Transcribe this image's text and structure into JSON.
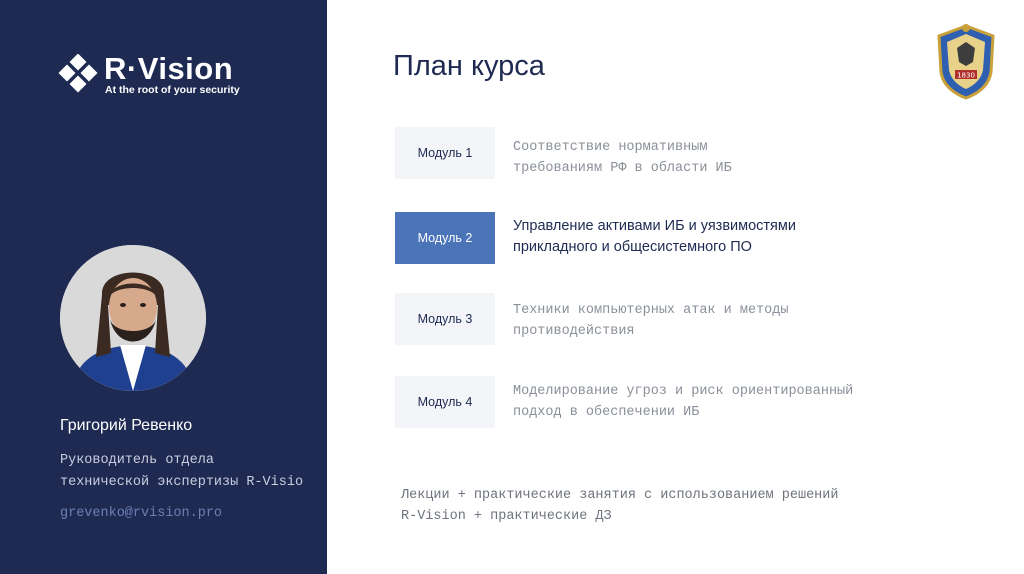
{
  "brand": {
    "name": "R·Vision",
    "tagline": "At the root of your security"
  },
  "speaker": {
    "name": "Григорий Ревенко",
    "role_line1": "Руководитель отдела",
    "role_line2": "технической экспертизы R-Visio",
    "email": "grevenko@rvision.pro"
  },
  "slide": {
    "title": "План курса",
    "crest_year": "1830"
  },
  "modules": [
    {
      "label": "Модуль 1",
      "line1": "Соответствие нормативным",
      "line2": "требованиям РФ в области ИБ",
      "active": false
    },
    {
      "label": "Модуль 2",
      "line1": "Управление активами ИБ и уязвимостями",
      "line2": "прикладного и общесистемного ПО",
      "active": true
    },
    {
      "label": "Модуль 3",
      "line1": "Техники компьютерных атак и методы",
      "line2": "противодействия",
      "active": false
    },
    {
      "label": "Модуль 4",
      "line1": "Моделирование угроз и риск ориентированный",
      "line2": "подход в обеспечении ИБ",
      "active": false
    }
  ],
  "footer": {
    "line1": "Лекции + практические занятия с использованием решений",
    "line2": "R-Vision + практические ДЗ"
  },
  "colors": {
    "sidebar": "#1f2a52",
    "accent": "#4b73b8",
    "module_bg": "#f4f5f8"
  }
}
